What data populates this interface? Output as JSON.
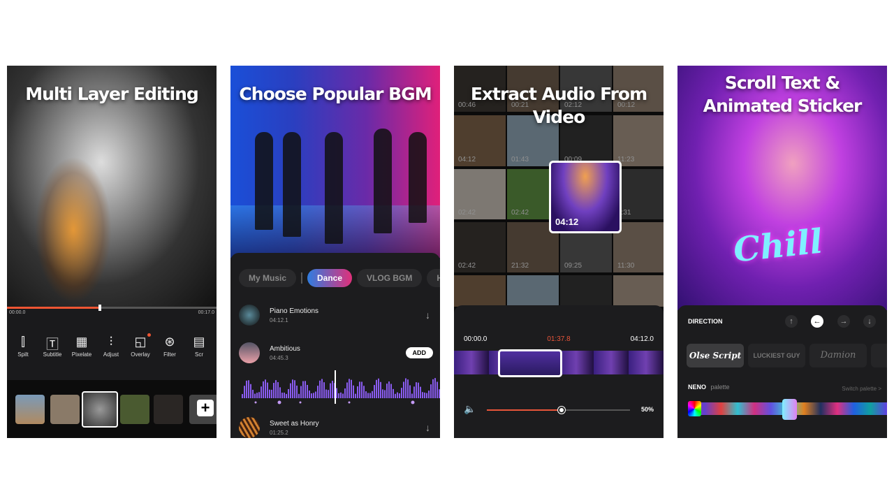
{
  "panels": {
    "multi_layer": {
      "title": "Multi Layer Editing",
      "time_start": "00:00.0",
      "time_end": "00:17.0",
      "progress": 0.44,
      "tools": [
        {
          "label": "Spilt",
          "icon": "split-icon"
        },
        {
          "label": "Subtitle",
          "icon": "text-icon"
        },
        {
          "label": "Pixelate",
          "icon": "pixelate-icon"
        },
        {
          "label": "Adjust",
          "icon": "sliders-icon"
        },
        {
          "label": "Overlay",
          "icon": "overlay-icon",
          "badge": true
        },
        {
          "label": "Filter",
          "icon": "filter-icon"
        },
        {
          "label": "Scr",
          "icon": "screen-icon"
        }
      ],
      "add_label": "+"
    },
    "bgm": {
      "title": "Choose Popular BGM",
      "tabs": [
        "My Music",
        "Dance",
        "VLOG BGM",
        "Happ"
      ],
      "active_tab": "Dance",
      "songs": [
        {
          "name": "Piano Emotions",
          "duration": "04:12.1",
          "action": "download"
        },
        {
          "name": "Ambitious",
          "duration": "04:45.3",
          "action": "ADD"
        },
        {
          "name": "Sweet as Honry",
          "duration": "01:25.2",
          "action": "download"
        }
      ],
      "accent": "#8a5cf0"
    },
    "extract": {
      "title": "Extract Audio From Video",
      "durations": [
        [
          "00:46",
          "00:21",
          "02:12",
          "00:12"
        ],
        [
          "04:12",
          "01:43",
          "00:09",
          "11:23"
        ],
        [
          "02:42",
          "02:42",
          "",
          "2:31"
        ],
        [
          "02:42",
          "21:32",
          "09:25",
          "11:30"
        ]
      ],
      "selected_duration": "04:12",
      "time_start": "00:00.0",
      "time_current": "01:37.8",
      "time_end": "04:12.0",
      "volume": "50%",
      "volume_value": 0.5,
      "accent": "#e9553a"
    },
    "sticker": {
      "title_line1": "Scroll Text &",
      "title_line2": "Animated Sticker",
      "sticker_text": "Chill",
      "direction_label": "DIRECTION",
      "fonts": [
        "Olse Script",
        "LUCKIEST GUY",
        "Damion",
        "Lo"
      ],
      "palette_name": "NENO",
      "palette_label": "palette",
      "switch_palette": "Switch palette >"
    }
  }
}
